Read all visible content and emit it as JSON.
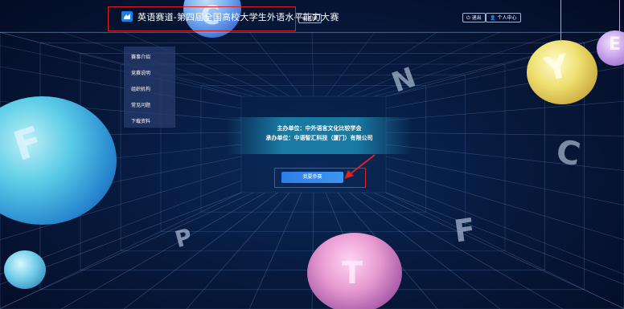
{
  "header": {
    "title": "英语赛道-第四届全国高校大学生外语水平能力大赛",
    "switch_label": "切换",
    "logout_label": "退出",
    "profile_label": "个人中心"
  },
  "sidebar": {
    "items": [
      {
        "label": "赛事介绍"
      },
      {
        "label": "竞赛说明"
      },
      {
        "label": "组织机构"
      },
      {
        "label": "常见问题"
      },
      {
        "label": "下载资料"
      }
    ]
  },
  "banner": {
    "host": "主办单位：中外语言文化比较学会",
    "co_host": "承办单位：中语智汇科技（厦门）有限公司"
  },
  "enter_button": {
    "label": "我要参赛"
  },
  "decorations": {
    "letters": [
      "C",
      "N",
      "F",
      "P",
      "F",
      "T",
      "Y",
      "E",
      "C"
    ]
  },
  "colors": {
    "background": "#06122e",
    "accent": "#2f7de8",
    "highlight_box": "#e02020"
  }
}
